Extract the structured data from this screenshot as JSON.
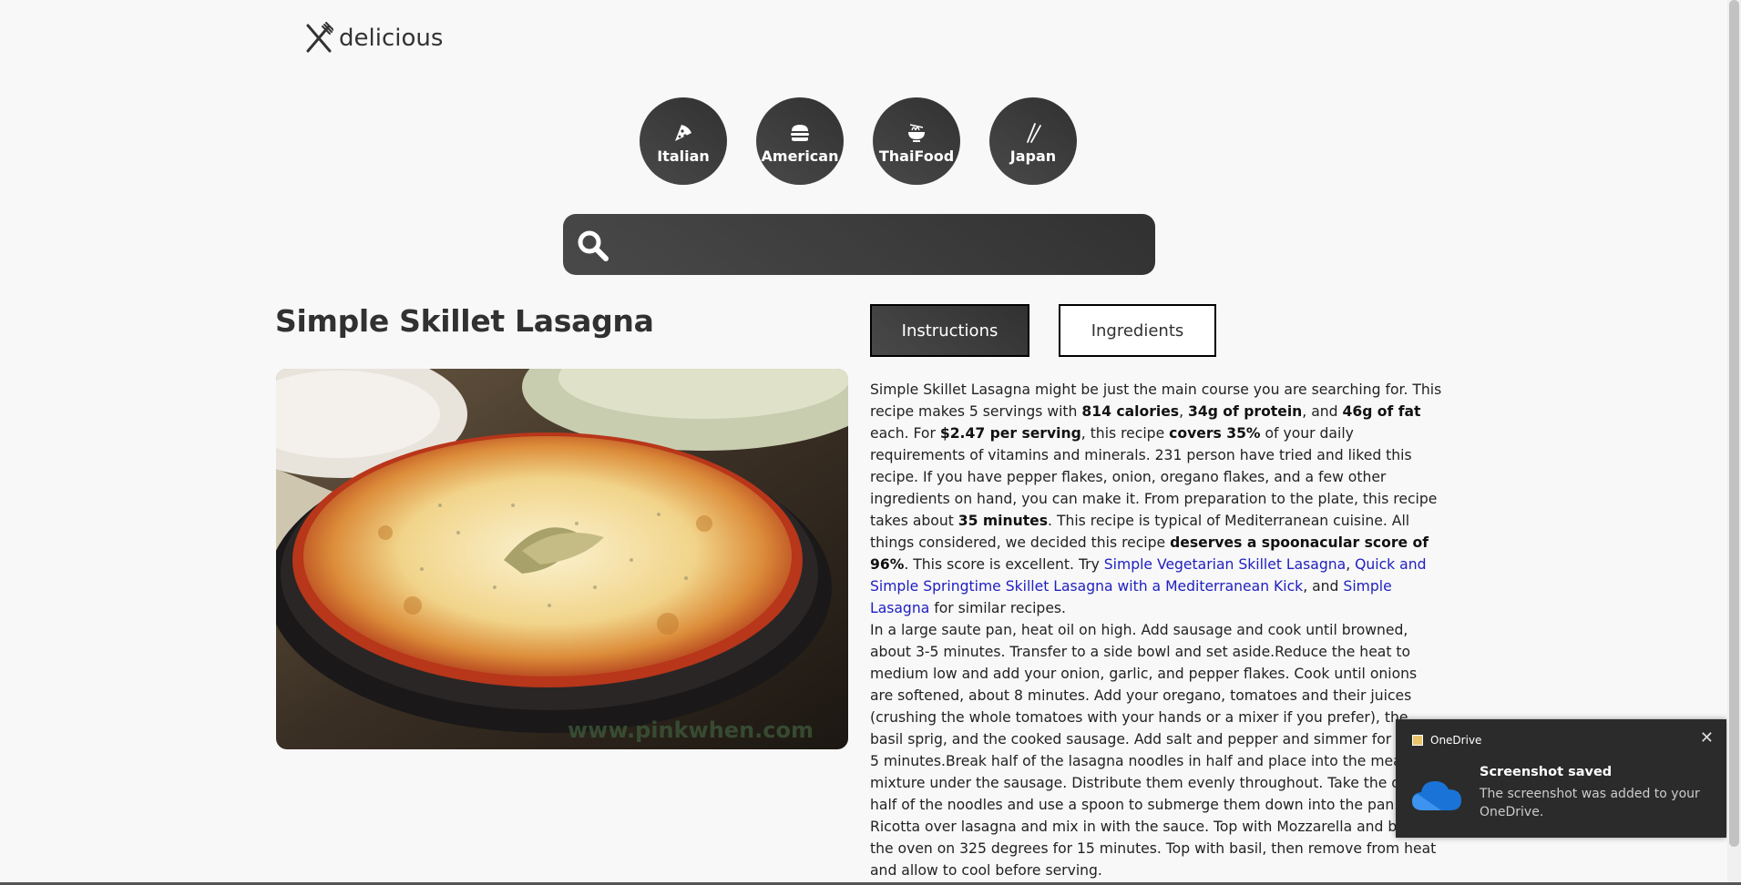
{
  "logo": {
    "text": "delicious",
    "icon": "fork-knife-icon"
  },
  "categories": [
    {
      "label": "Italian",
      "icon": "pizza-icon"
    },
    {
      "label": "American",
      "icon": "burger-icon"
    },
    {
      "label": "ThaiFood",
      "icon": "noodle-bowl-icon"
    },
    {
      "label": "Japan",
      "icon": "chopsticks-icon"
    }
  ],
  "search": {
    "value": "",
    "icon": "search-icon"
  },
  "recipe": {
    "title": "Simple Skillet Lasagna",
    "image_watermark": "www.pinkwhen.com",
    "tabs": {
      "instructions": "Instructions",
      "ingredients": "Ingredients"
    },
    "summary": {
      "s1": "Simple Skillet Lasagna might be just the main course you are searching for. This recipe makes 5 servings with ",
      "b1": "814 calories",
      "s2": ", ",
      "b2": "34g of protein",
      "s3": ", and ",
      "b3": "46g of fat",
      "s4": " each. For ",
      "b4": "$2.47 per serving",
      "s5": ", this recipe ",
      "b5": "covers 35%",
      "s6": " of your daily requirements of vitamins and minerals. 231 person have tried and liked this recipe. If you have pepper flakes, onion, oregano flakes, and a few other ingredients on hand, you can make it. From preparation to the plate, this recipe takes about ",
      "b6": "35 minutes",
      "s7": ". This recipe is typical of Mediterranean cuisine. All things considered, we decided this recipe ",
      "b7": "deserves a spoonacular score of 96%",
      "s8": ". This score is excellent. Try ",
      "l1": "Simple Vegetarian Skillet Lasagna",
      "s9": ", ",
      "l2": "Quick and Simple Springtime Skillet Lasagna with a Mediterranean Kick",
      "s10": ", and ",
      "l3": "Simple Lasagna",
      "s11": " for similar recipes."
    },
    "instructions": "In a large saute pan, heat oil on high. Add sausage and cook until browned, about 3-5 minutes. Transfer to a side bowl and set aside.Reduce the heat to medium low and add your onion, garlic, and pepper flakes. Cook until onions are softened, about 8 minutes. Add your oregano, tomatoes and their juices (crushing the whole tomatoes with your hands or a mixer if you prefer), the basil sprig, and the cooked sausage. Add salt and pepper and simmer for about 5 minutes.Break half of the lasagna noodles in half and place into the meat mixture under the sausage. Distribute them evenly throughout. Take the other half of the noodles and use a spoon to submerge them down into the pan.Dollop Ricotta over lasagna and mix in with the sauce. Top with Mozzarella and bake in the oven on 325 degrees for 15 minutes. Top with basil, then remove from heat and allow to cool before serving."
  },
  "notification": {
    "app": "OneDrive",
    "title": "Screenshot saved",
    "message": "The screenshot was added to your OneDrive.",
    "close_glyph": "✕"
  },
  "colors": {
    "accent_dark": "#313131",
    "link": "#2020c0",
    "toast_bg": "#2b2b2b"
  }
}
